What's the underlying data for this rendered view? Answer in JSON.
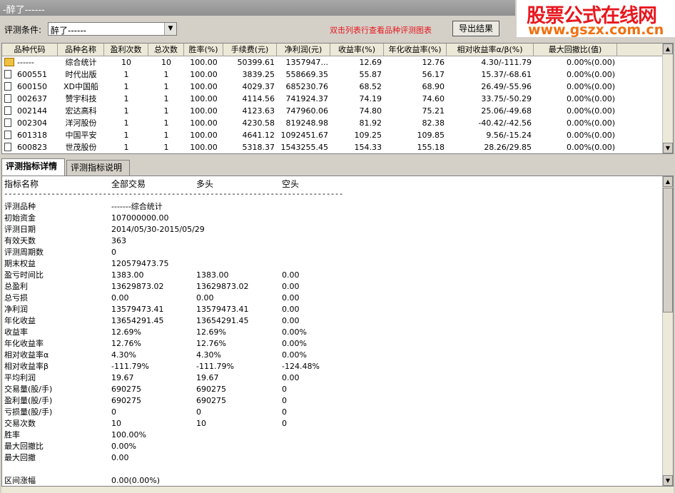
{
  "window": {
    "title": "-醉了------"
  },
  "watermark": {
    "line1": "股票公式在线网",
    "line2": "www.gszx.com.cn"
  },
  "toolbar": {
    "cond_label": "评测条件:",
    "cond_value": "醉了------",
    "hint": "双击列表行查看品种评测图表",
    "export_label": "导出结果"
  },
  "table": {
    "columns": [
      "品种代码",
      "品种名称",
      "盈利次数",
      "总次数",
      "胜率(%)",
      "手续费(元)",
      "净利润(元)",
      "收益率(%)",
      "年化收益率(%)",
      "相对收益率α/β(%)",
      "最大回撤比(值)"
    ],
    "rows": [
      {
        "code": "------",
        "name": "综合统计",
        "win": "10",
        "total": "10",
        "rate": "100.00",
        "fee": "50399.61",
        "profit": "1357947...",
        "ret": "12.69",
        "annual": "12.76",
        "ab": "4.30/-111.79",
        "dd": "0.00%(0.00)"
      },
      {
        "code": "600551",
        "name": "时代出版",
        "win": "1",
        "total": "1",
        "rate": "100.00",
        "fee": "3839.25",
        "profit": "558669.35",
        "ret": "55.87",
        "annual": "56.17",
        "ab": "15.37/-68.61",
        "dd": "0.00%(0.00)"
      },
      {
        "code": "600150",
        "name": "XD中国船",
        "win": "1",
        "total": "1",
        "rate": "100.00",
        "fee": "4029.37",
        "profit": "685230.76",
        "ret": "68.52",
        "annual": "68.90",
        "ab": "26.49/-55.96",
        "dd": "0.00%(0.00)"
      },
      {
        "code": "002637",
        "name": "赞宇科技",
        "win": "1",
        "total": "1",
        "rate": "100.00",
        "fee": "4114.56",
        "profit": "741924.37",
        "ret": "74.19",
        "annual": "74.60",
        "ab": "33.75/-50.29",
        "dd": "0.00%(0.00)"
      },
      {
        "code": "002144",
        "name": "宏达高科",
        "win": "1",
        "total": "1",
        "rate": "100.00",
        "fee": "4123.63",
        "profit": "747960.06",
        "ret": "74.80",
        "annual": "75.21",
        "ab": "25.06/-49.68",
        "dd": "0.00%(0.00)"
      },
      {
        "code": "002304",
        "name": "洋河股份",
        "win": "1",
        "total": "1",
        "rate": "100.00",
        "fee": "4230.58",
        "profit": "819248.98",
        "ret": "81.92",
        "annual": "82.38",
        "ab": "-40.42/-42.56",
        "dd": "0.00%(0.00)"
      },
      {
        "code": "601318",
        "name": "中国平安",
        "win": "1",
        "total": "1",
        "rate": "100.00",
        "fee": "4641.12",
        "profit": "1092451.67",
        "ret": "109.25",
        "annual": "109.85",
        "ab": "9.56/-15.24",
        "dd": "0.00%(0.00)"
      },
      {
        "code": "600823",
        "name": "世茂股份",
        "win": "1",
        "total": "1",
        "rate": "100.00",
        "fee": "5318.37",
        "profit": "1543255.45",
        "ret": "154.33",
        "annual": "155.18",
        "ab": "28.26/29.85",
        "dd": "0.00%(0.00)"
      }
    ]
  },
  "tabs": [
    {
      "label": "评测指标详情"
    },
    {
      "label": "评测指标说明"
    }
  ],
  "detail": {
    "headers": [
      "指标名称",
      "全部交易",
      "多头",
      "空头"
    ],
    "divider": "-------------------------------------------------------------------------------",
    "rows": [
      [
        "评测品种",
        "-------综合统计",
        "",
        ""
      ],
      [
        "初始资金",
        "107000000.00",
        "",
        ""
      ],
      [
        "评测日期",
        "2014/05/30-2015/05/29",
        "",
        ""
      ],
      [
        "有效天数",
        "363",
        "",
        ""
      ],
      [
        "评测周期数",
        "0",
        "",
        ""
      ],
      [
        "期末权益",
        "120579473.75",
        "",
        ""
      ],
      [
        "盈亏时间比",
        "1383.00",
        "1383.00",
        "0.00"
      ],
      [
        "总盈利",
        "13629873.02",
        "13629873.02",
        "0.00"
      ],
      [
        "总亏损",
        "0.00",
        "0.00",
        "0.00"
      ],
      [
        "净利润",
        "13579473.41",
        "13579473.41",
        "0.00"
      ],
      [
        "年化收益",
        "13654291.45",
        "13654291.45",
        "0.00"
      ],
      [
        "收益率",
        "12.69%",
        "12.69%",
        "0.00%"
      ],
      [
        "年化收益率",
        "12.76%",
        "12.76%",
        "0.00%"
      ],
      [
        "相对收益率α",
        "4.30%",
        "4.30%",
        "0.00%"
      ],
      [
        "相对收益率β",
        "-111.79%",
        "-111.79%",
        "-124.48%"
      ],
      [
        "平均利润",
        "19.67",
        "19.67",
        "0.00"
      ],
      [
        "交易量(股/手)",
        "690275",
        "690275",
        "0"
      ],
      [
        "盈利量(股/手)",
        "690275",
        "690275",
        "0"
      ],
      [
        "亏损量(股/手)",
        "0",
        "0",
        "0"
      ],
      [
        "交易次数",
        "10",
        "10",
        "0"
      ],
      [
        "胜率",
        "100.00%",
        "",
        ""
      ],
      [
        "最大回撤比",
        "0.00%",
        "",
        ""
      ],
      [
        "最大回撤",
        "0.00",
        "",
        ""
      ],
      [
        "",
        "",
        "",
        ""
      ],
      [
        "区间涨幅",
        "0.00(0.00%)",
        "",
        ""
      ]
    ]
  }
}
